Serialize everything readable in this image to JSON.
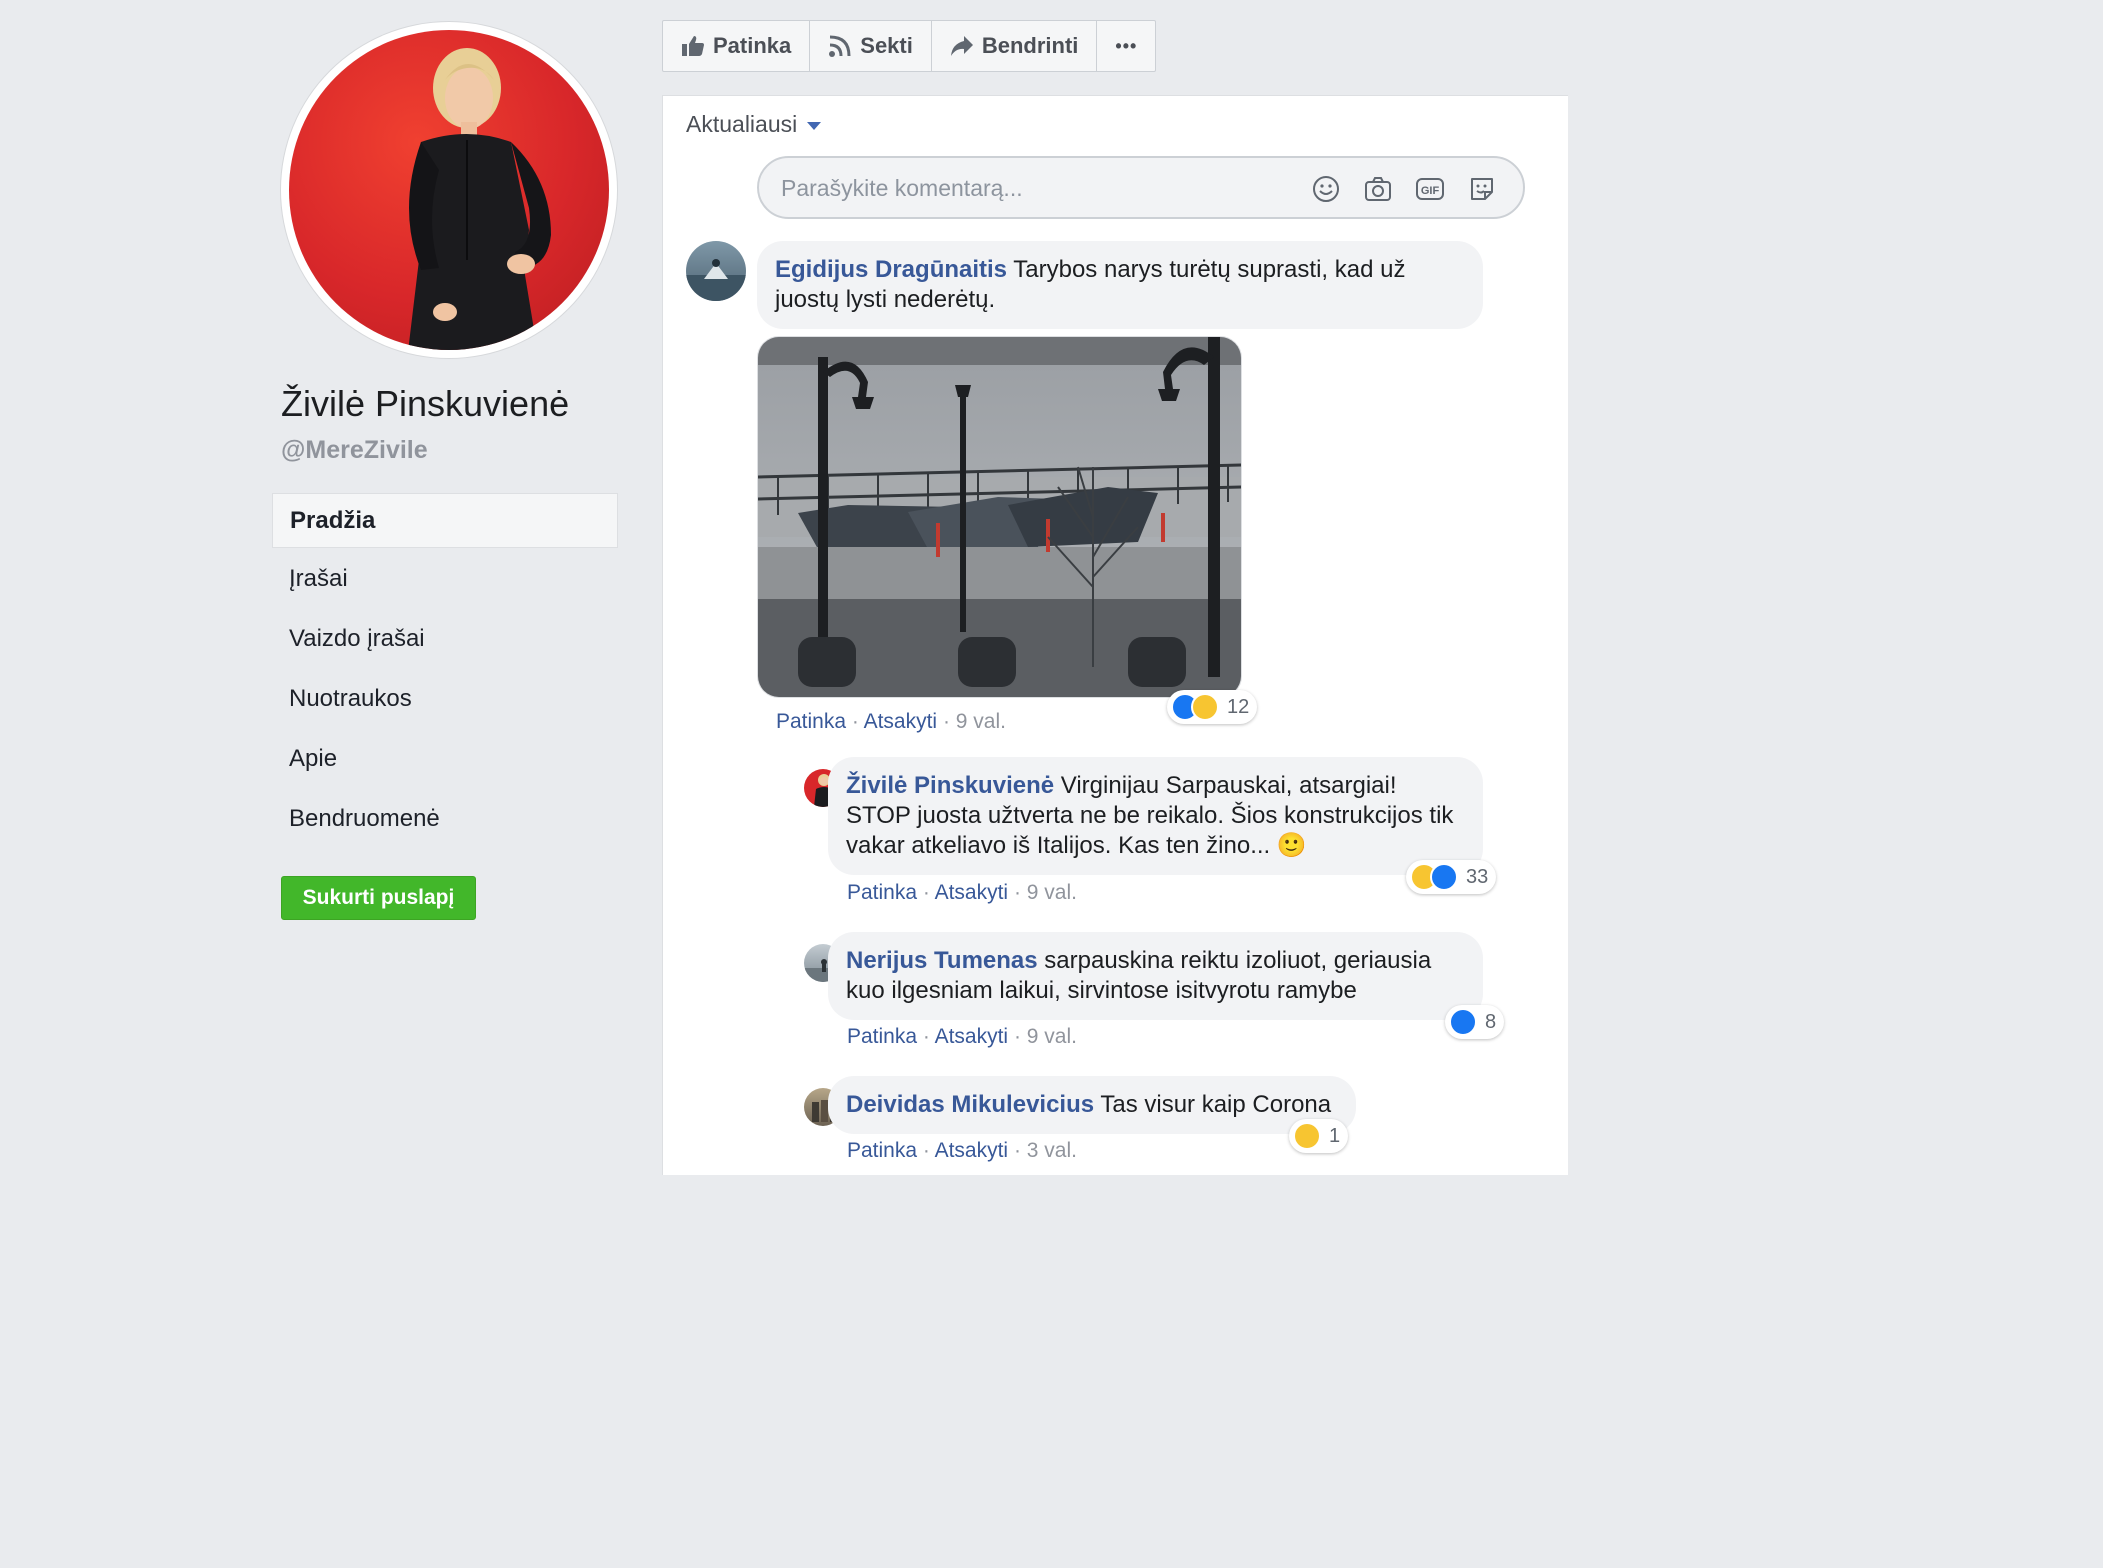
{
  "page": {
    "name": "Živilė Pinskuvienė",
    "handle": "@MereZivile",
    "nav": [
      {
        "label": "Pradžia",
        "active": true
      },
      {
        "label": "Įrašai"
      },
      {
        "label": "Vaizdo įrašai"
      },
      {
        "label": "Nuotraukos"
      },
      {
        "label": "Apie"
      },
      {
        "label": "Bendruomenė"
      }
    ],
    "create_button": "Sukurti puslapį"
  },
  "actions": {
    "like": "Patinka",
    "follow": "Sekti",
    "share": "Bendrinti",
    "more": "•••"
  },
  "comments_section": {
    "sort_label": "Aktualiausi",
    "input_placeholder": "Parašykite komentarą..."
  },
  "comments": [
    {
      "author": "Egidijus Dragūnaitis",
      "text": "Tarybos narys turėtų suprasti, kad už juostų lysti nederėtų.",
      "has_photo": true,
      "like_label": "Patinka",
      "reply_label": "Atsakyti",
      "time": "9 val.",
      "reaction_count": "12",
      "reactions": [
        "like-icon",
        "haha-icon"
      ]
    },
    {
      "author": "Živilė Pinskuvienė",
      "text": "Virginijau Sarpauskai, atsargiai! STOP juosta užtverta ne be reikalo. Šios konstrukcijos tik vakar atkeliavo iš Italijos. Kas ten žino... 🙂",
      "like_label": "Patinka",
      "reply_label": "Atsakyti",
      "time": "9 val.",
      "reaction_count": "33",
      "reactions": [
        "haha-icon",
        "like-icon"
      ]
    },
    {
      "author": "Nerijus Tumenas",
      "text": "sarpauskina reiktu izoliuot, geriausia kuo ilgesniam laikui, sirvintose isitvyrotu ramybe",
      "like_label": "Patinka",
      "reply_label": "Atsakyti",
      "time": "9 val.",
      "reaction_count": "8",
      "reactions": [
        "like-icon"
      ]
    },
    {
      "author": "Deividas Mikulevicius",
      "text": "Tas visur kaip Corona",
      "like_label": "Patinka",
      "reply_label": "Atsakyti",
      "time": "3 val.",
      "reaction_count": "1",
      "reactions": [
        "haha-icon"
      ]
    }
  ],
  "colors": {
    "link": "#385898",
    "accent_green": "#42b72a",
    "like_blue": "#1877f2",
    "haha_yellow": "#f7c531",
    "avatar_red": "#d8272a"
  }
}
